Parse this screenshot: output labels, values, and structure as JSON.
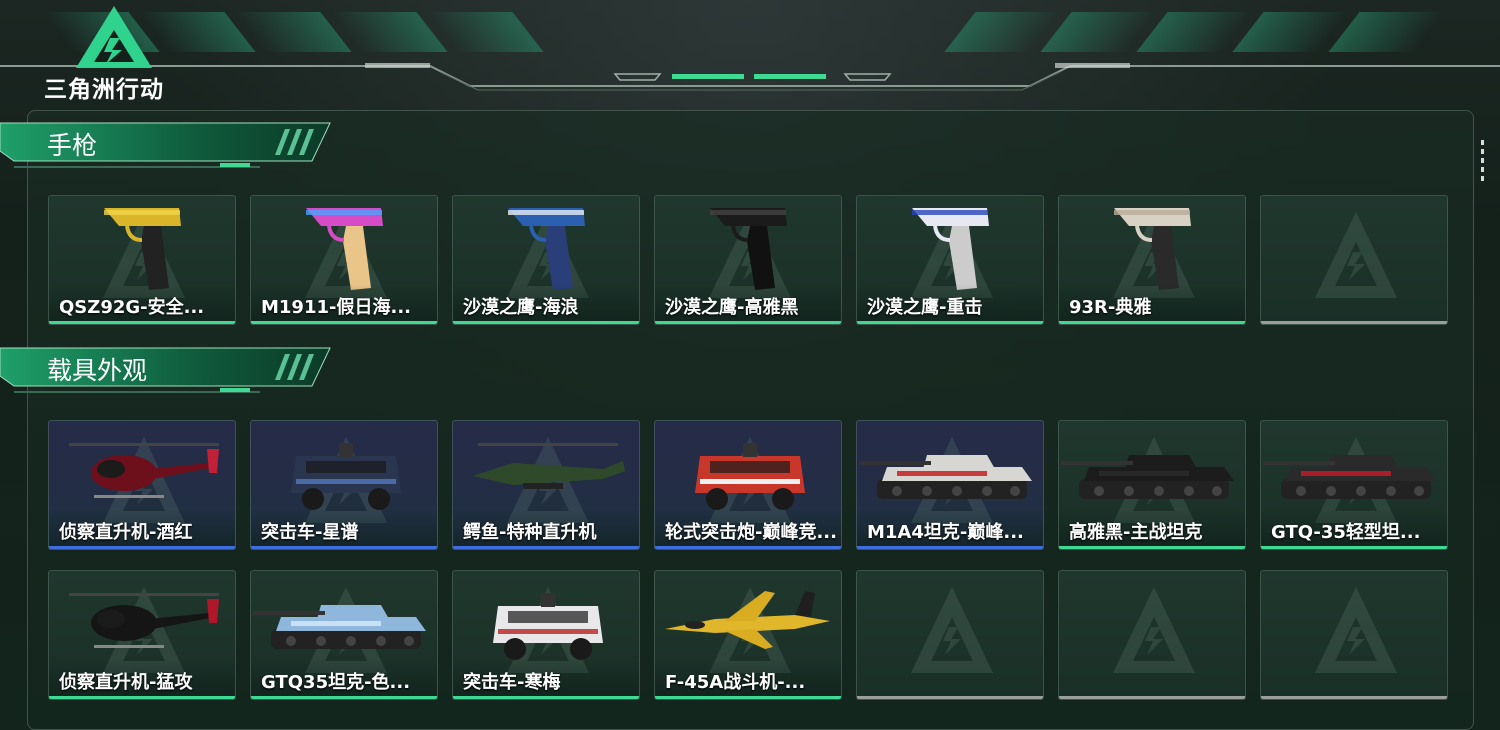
{
  "brand": {
    "title": "三角洲行动"
  },
  "colors": {
    "accent_green": "#3fd993",
    "accent_blue": "#3f6ee0",
    "empty_gray": "#9a9f9c",
    "logo_green": "#2fd38e"
  },
  "sections": [
    {
      "title": "手枪",
      "items": [
        {
          "name": "QSZ92G-安全...",
          "rarity": "green",
          "icon": "pistol-yellow-icon"
        },
        {
          "name": "M1911-假日海...",
          "rarity": "green",
          "icon": "pistol-pink-icon"
        },
        {
          "name": "沙漠之鹰-海浪",
          "rarity": "green",
          "icon": "pistol-wave-icon"
        },
        {
          "name": "沙漠之鹰-高雅黑",
          "rarity": "green",
          "icon": "pistol-black-icon"
        },
        {
          "name": "沙漠之鹰-重击",
          "rarity": "green",
          "icon": "pistol-white-blue-icon"
        },
        {
          "name": "93R-典雅",
          "rarity": "green",
          "icon": "pistol-cream-icon"
        },
        {
          "name": "",
          "rarity": "empty",
          "icon": "delta-logo-watermark-icon"
        }
      ]
    },
    {
      "title": "载具外观",
      "items": [
        {
          "name": "侦察直升机-酒红",
          "rarity": "blue",
          "icon": "helicopter-red-icon"
        },
        {
          "name": "突击车-星谱",
          "rarity": "blue",
          "icon": "assault-car-icon"
        },
        {
          "name": "鳄鱼-特种直升机",
          "rarity": "blue",
          "icon": "attack-helicopter-icon"
        },
        {
          "name": "轮式突击炮-巅峰竞...",
          "rarity": "blue",
          "icon": "wheeled-assault-gun-icon"
        },
        {
          "name": "M1A4坦克-巅峰...",
          "rarity": "blue",
          "icon": "tank-red-white-icon"
        },
        {
          "name": "高雅黑-主战坦克",
          "rarity": "green",
          "icon": "tank-black-icon"
        },
        {
          "name": "GTQ-35轻型坦...",
          "rarity": "green",
          "icon": "tank-light-icon"
        },
        {
          "name": "侦察直升机-猛攻",
          "rarity": "green",
          "icon": "helicopter-black-icon"
        },
        {
          "name": "GTQ35坦克-色...",
          "rarity": "green",
          "icon": "tank-blue-icon"
        },
        {
          "name": "突击车-寒梅",
          "rarity": "green",
          "icon": "assault-car-white-icon"
        },
        {
          "name": "F-45A战斗机-...",
          "rarity": "green",
          "icon": "fighter-jet-yellow-icon"
        },
        {
          "name": "",
          "rarity": "empty",
          "icon": "delta-logo-watermark-icon"
        },
        {
          "name": "",
          "rarity": "empty",
          "icon": "delta-logo-watermark-icon"
        },
        {
          "name": "",
          "rarity": "empty",
          "icon": "delta-logo-watermark-icon"
        }
      ]
    }
  ]
}
